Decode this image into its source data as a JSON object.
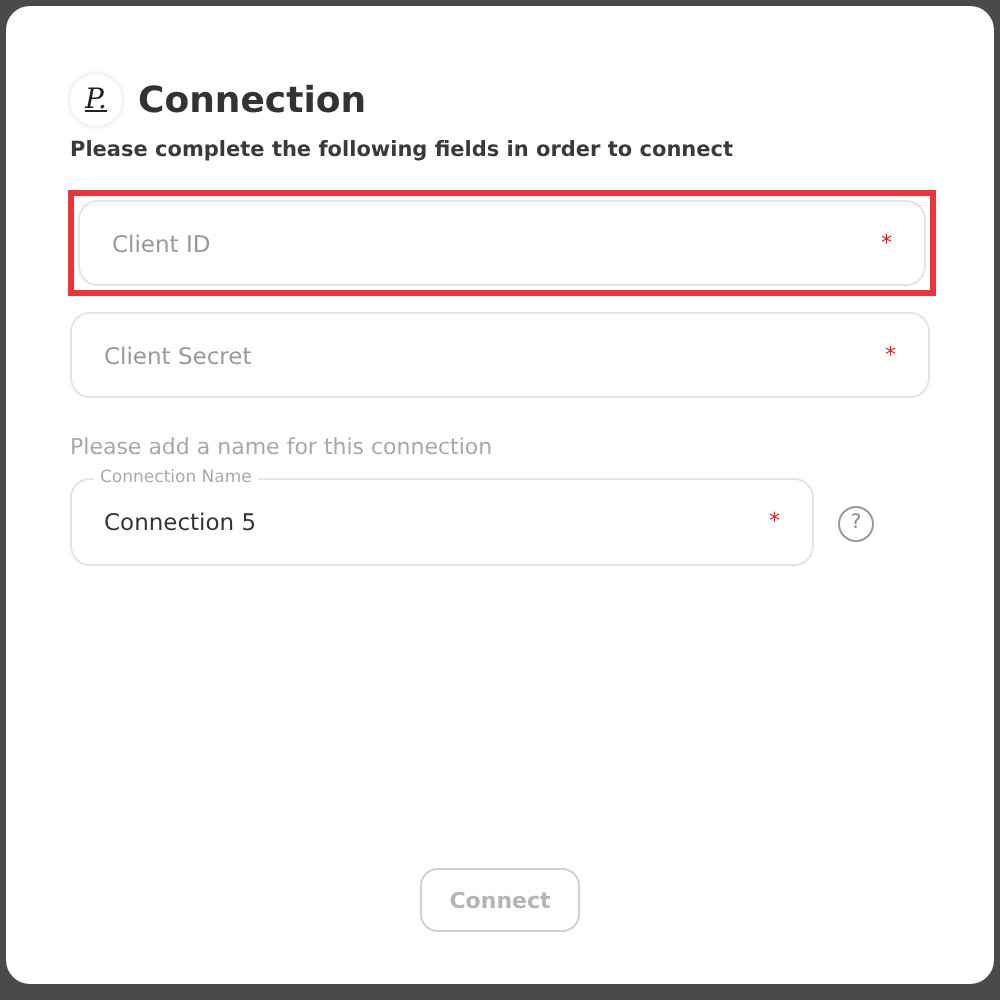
{
  "dialog": {
    "logo": "P.",
    "title": "Connection",
    "subtitle": "Please complete the following fields in order to connect"
  },
  "fields": [
    {
      "placeholder": "Client ID",
      "mark": "*",
      "highlighted": true
    },
    {
      "placeholder": "Client Secret",
      "mark": "*",
      "highlighted": false
    }
  ],
  "name_section": {
    "hint": "Please add a name for this connection",
    "field": {
      "label": "Connection Name",
      "value": "Connection 5",
      "mark": "*"
    },
    "help": "?"
  },
  "connect_button": {
    "label": "Connect",
    "disabled": true
  }
}
